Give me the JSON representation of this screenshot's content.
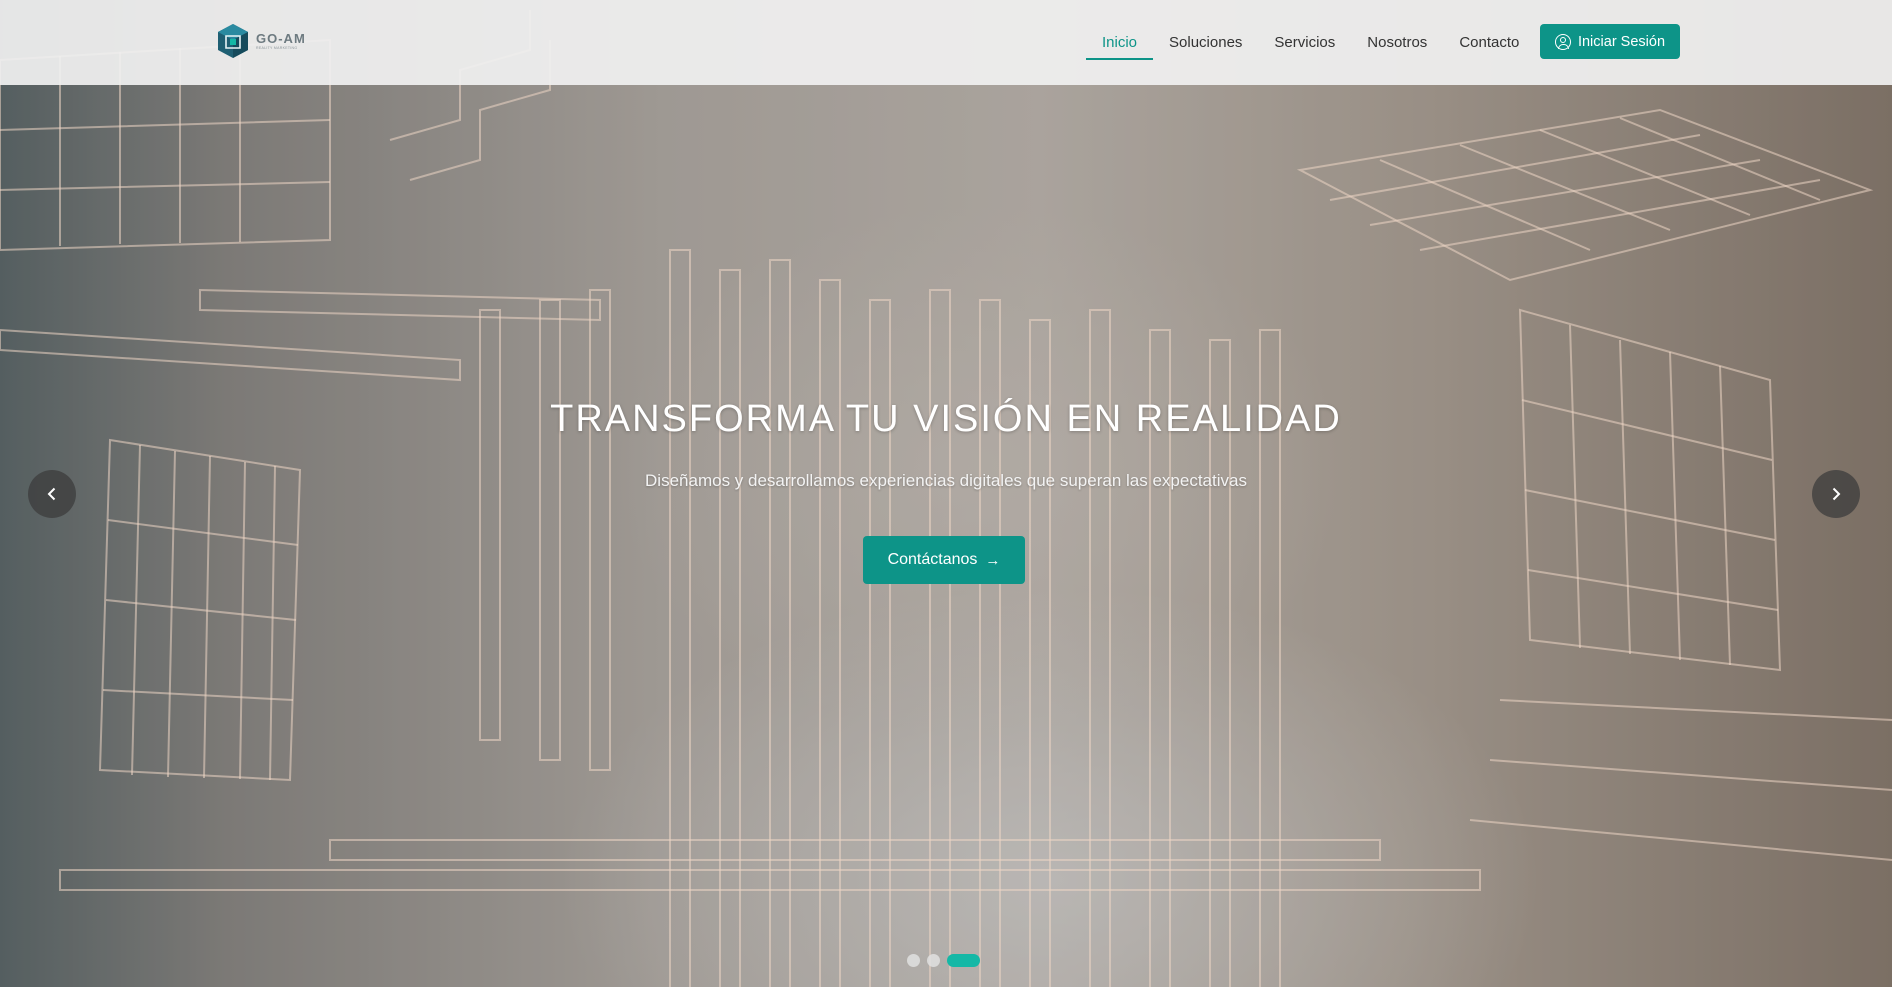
{
  "brand": {
    "name": "GO-AM",
    "tagline": "Reality Marketing",
    "accent_color": "#0d9488"
  },
  "nav": {
    "items": [
      {
        "label": "Inicio",
        "active": true
      },
      {
        "label": "Soluciones",
        "active": false
      },
      {
        "label": "Servicios",
        "active": false
      },
      {
        "label": "Nosotros",
        "active": false
      },
      {
        "label": "Contacto",
        "active": false
      }
    ],
    "login_label": "Iniciar Sesión",
    "login_icon": "user-circle-icon"
  },
  "hero": {
    "title": "TRANSFORMA TU VISIÓN EN REALIDAD",
    "subtitle": "Diseñamos y desarrollamos experiencias digitales que superan las expectativas",
    "cta_label": "Contáctanos",
    "cta_icon": "arrow-right-icon",
    "prev_icon": "chevron-left-icon",
    "next_icon": "chevron-right-icon"
  },
  "carousel": {
    "slide_count": 3,
    "active_slide": 3
  }
}
